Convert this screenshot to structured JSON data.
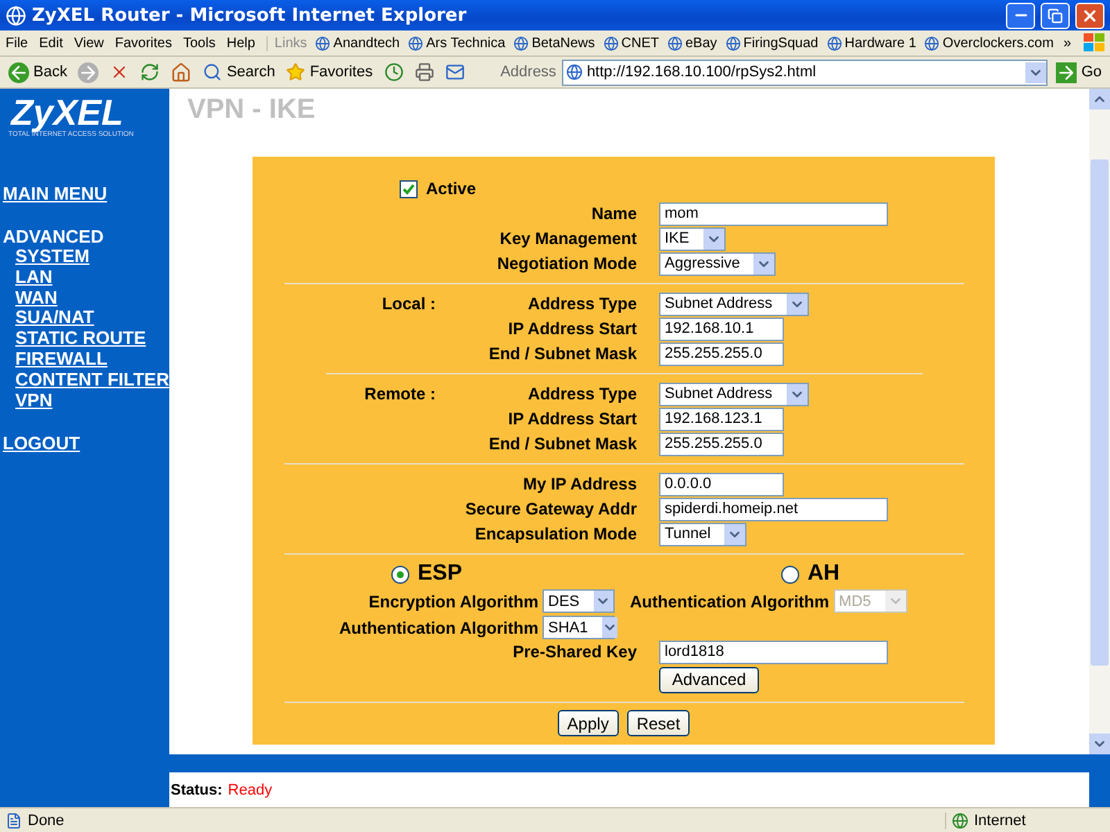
{
  "window": {
    "title": "ZyXEL Router - Microsoft Internet Explorer"
  },
  "menu": [
    "File",
    "Edit",
    "View",
    "Favorites",
    "Tools",
    "Help"
  ],
  "links": {
    "label": "Links",
    "items": [
      "Anandtech",
      "Ars Technica",
      "BetaNews",
      "CNET",
      "eBay",
      "FiringSquad",
      "Hardware 1",
      "Overclockers.com"
    ],
    "more": "»"
  },
  "toolbar": {
    "back": "Back",
    "search": "Search",
    "favorites": "Favorites"
  },
  "address": {
    "label": "Address",
    "value": "http://192.168.10.100/rpSys2.html",
    "go": "Go"
  },
  "sidebar": {
    "logo": "ZyXEL",
    "tagline": "TOTAL INTERNET ACCESS SOLUTION",
    "items": [
      {
        "label": "MAIN MENU"
      },
      {
        "label": "ADVANCED",
        "children": [
          {
            "label": "SYSTEM"
          },
          {
            "label": "LAN"
          },
          {
            "label": "WAN"
          },
          {
            "label": "SUA/NAT"
          },
          {
            "label": "STATIC ROUTE"
          },
          {
            "label": "FIREWALL"
          },
          {
            "label": "CONTENT FILTER"
          },
          {
            "label": "VPN"
          }
        ]
      },
      {
        "label": "LOGOUT"
      }
    ]
  },
  "page_title": "VPN - IKE",
  "form": {
    "active": {
      "label": "Active",
      "checked": true
    },
    "groups": [
      [
        {
          "label": "Name",
          "kind": "long-text",
          "value": "mom"
        },
        {
          "label": "Key Management",
          "kind": "select",
          "value": "IKE"
        },
        {
          "label": "Negotiation Mode",
          "kind": "select",
          "value": "Aggressive"
        }
      ],
      [
        {
          "section": "Local :",
          "label": "Address Type",
          "kind": "select",
          "value": "Subnet Address"
        },
        {
          "label": "IP Address Start",
          "kind": "short-text",
          "value": "192.168.10.1"
        },
        {
          "label": "End / Subnet Mask",
          "kind": "short-text",
          "value": "255.255.255.0"
        }
      ],
      [
        {
          "section": "Remote :",
          "label": "Address Type",
          "kind": "select",
          "value": "Subnet Address"
        },
        {
          "label": "IP Address Start",
          "kind": "short-text",
          "value": "192.168.123.1"
        },
        {
          "label": "End / Subnet Mask",
          "kind": "short-text",
          "value": "255.255.255.0"
        }
      ],
      [
        {
          "label": "My IP Address",
          "kind": "short-text",
          "value": "0.0.0.0"
        },
        {
          "label": "Secure Gateway Addr",
          "kind": "long-text",
          "value": "spiderdi.homeip.net"
        },
        {
          "label": "Encapsulation Mode",
          "kind": "select",
          "value": "Tunnel"
        }
      ]
    ],
    "protocols": [
      {
        "label": "ESP",
        "selected": true,
        "fields": [
          {
            "label": "Encryption Algorithm",
            "value": "DES",
            "disabled": false
          },
          {
            "label": "Authentication Algorithm",
            "value": "SHA1",
            "disabled": false
          }
        ]
      },
      {
        "label": "AH",
        "selected": false,
        "fields": [
          {
            "label": "Authentication Algorithm",
            "value": "MD5",
            "disabled": true
          }
        ]
      }
    ],
    "psk": {
      "label": "Pre-Shared Key",
      "value": "lord1818"
    },
    "advanced": "Advanced",
    "buttons": [
      "Apply",
      "Reset"
    ]
  },
  "status": {
    "label": "Status:",
    "value": "Ready"
  },
  "ie_status": {
    "text": "Done",
    "zone": "Internet"
  }
}
